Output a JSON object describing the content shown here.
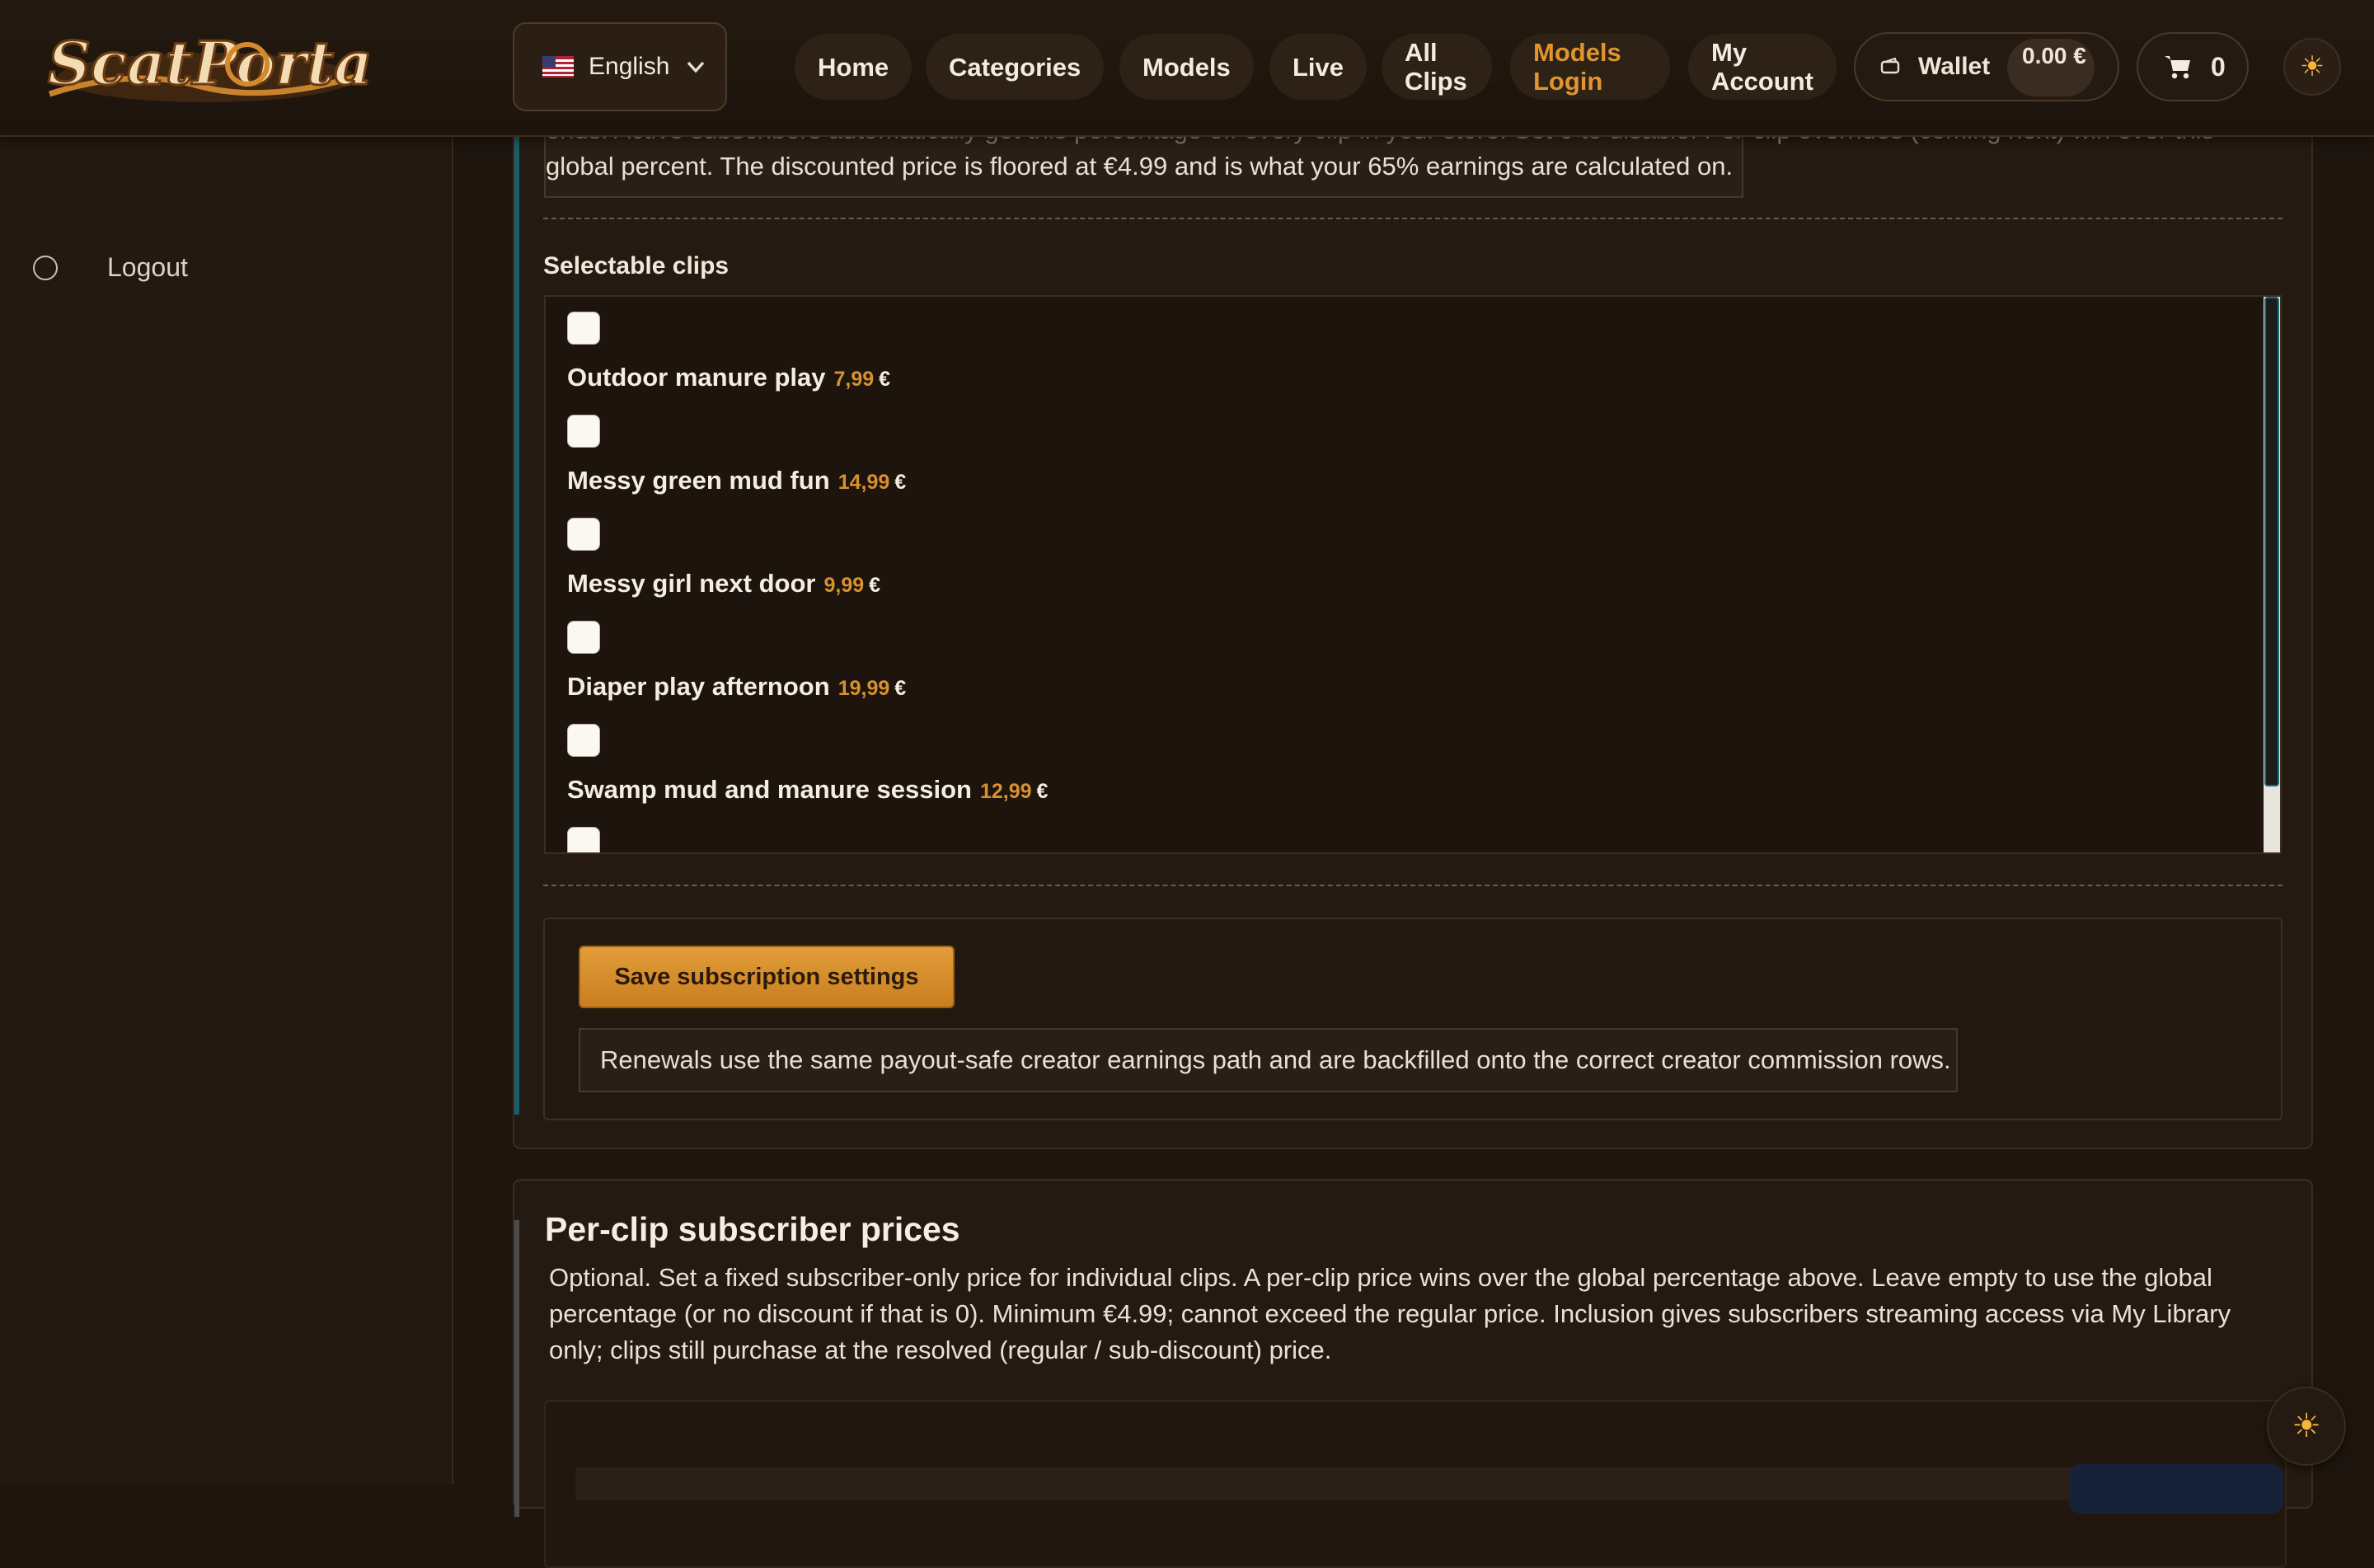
{
  "header": {
    "logo_text": "ScatPortal",
    "language": "English",
    "nav": [
      {
        "label": "Home"
      },
      {
        "label": "Categories"
      },
      {
        "label": "Models"
      },
      {
        "label": "Live"
      },
      {
        "label": "All Clips"
      },
      {
        "label": "Models Login"
      },
      {
        "label": "My Account"
      }
    ],
    "wallet_label": "Wallet",
    "wallet_balance": "0.00 €",
    "cart_count": "0",
    "accent_color": "#e0952f"
  },
  "sidebar": {
    "logout_label": "Logout"
  },
  "subscription": {
    "intro_ghost": "ends.    Active subscribers automatically get this percentage off every clip in your store. Set 0 to disable. Per-clip overrides (coming next) win over this",
    "intro_text": "global percent. The discounted price is floored at €4.99 and is what your 65% earnings are calculated on.",
    "selectable_label": "Selectable clips",
    "clips": [
      {
        "name": "Outdoor manure play",
        "price": "7,99",
        "currency": "€"
      },
      {
        "name": "Messy green mud fun",
        "price": "14,99",
        "currency": "€"
      },
      {
        "name": "Messy girl next door",
        "price": "9,99",
        "currency": "€"
      },
      {
        "name": "Diaper play afternoon",
        "price": "19,99",
        "currency": "€"
      },
      {
        "name": "Swamp mud and manure session",
        "price": "12,99",
        "currency": "€"
      }
    ],
    "save_label": "Save subscription settings",
    "save_note": "Renewals use the same payout-safe creator earnings path and are backfilled onto the correct creator commission rows."
  },
  "per_clip": {
    "title": "Per-clip subscriber prices",
    "description": "Optional. Set a fixed subscriber-only price for individual clips. A per-clip price wins over the global percentage above. Leave empty to use the global percentage (or no discount if that is 0). Minimum €4.99; cannot exceed the regular price. Inclusion gives subscribers streaming access via My Library only; clips still purchase at the resolved (regular / sub-discount) price."
  }
}
